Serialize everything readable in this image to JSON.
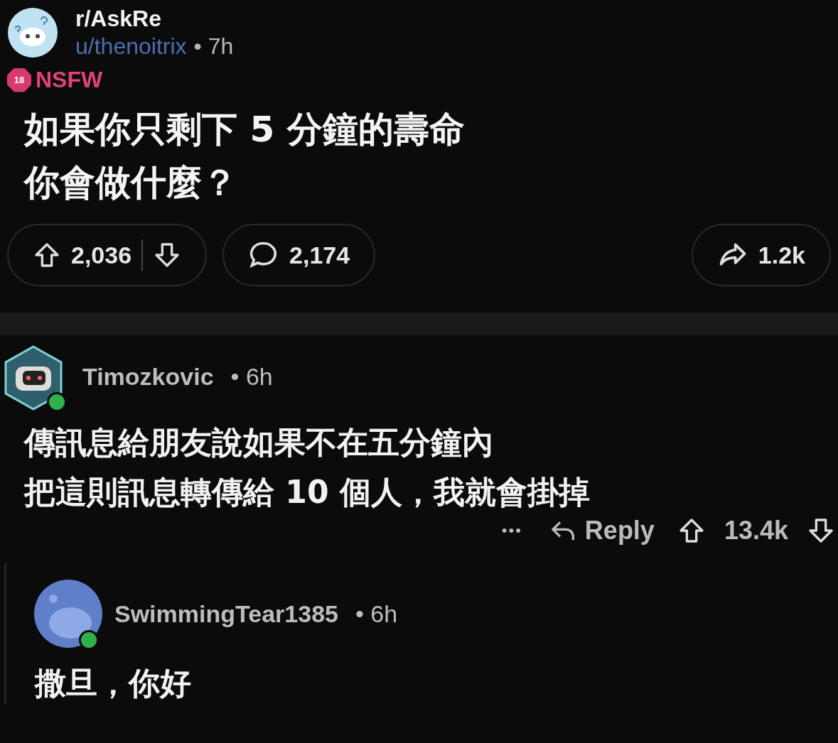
{
  "post": {
    "subreddit": "r/AskRe",
    "author": "u/thenoitrix",
    "separator": "•",
    "time": "7h",
    "nsfw": true,
    "nsfw_badge": "18",
    "nsfw_label": "NSFW",
    "title_lines": [
      "如果你只剩下 5 分鐘的壽命",
      "你會做什麼？"
    ],
    "upvotes": "2,036",
    "comments": "2,174",
    "shares": "1.2k"
  },
  "comments": [
    {
      "author": "Timozkovic",
      "separator": "•",
      "time": "6h",
      "online": true,
      "avatar": {
        "kind": "robot"
      },
      "lines": [
        "傳訊息給朋友說如果不在五分鐘內",
        "把這則訊息轉傳給 10 個人，我就會掛掉"
      ],
      "reply": "Reply",
      "more": "•••",
      "score": "13.4k",
      "replies": [
        {
          "author": "SwimmingTear1385",
          "separator": "•",
          "time": "6h",
          "online": true,
          "avatar": {
            "kind": "default"
          },
          "lines": [
            "撒旦，你好"
          ]
        }
      ]
    }
  ]
}
